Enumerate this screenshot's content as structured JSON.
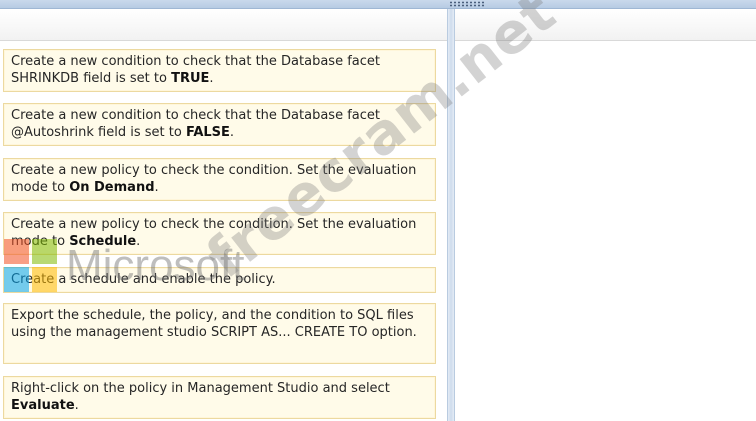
{
  "options": [
    {
      "pre": "Create a new condition to check that the Database facet SHRINKDB field is set to ",
      "strong": "TRUE",
      "post": "."
    },
    {
      "pre": "Create a new condition to check that the Database facet @Autoshrink field is set to ",
      "strong": "FALSE",
      "post": "."
    },
    {
      "pre": "Create a new policy to check the condition. Set the evaluation mode to ",
      "strong": "On Demand",
      "post": "."
    },
    {
      "pre": "Create a new policy to check the condition. Set the evaluation mode to ",
      "strong": "Schedule",
      "post": "."
    },
    {
      "pre": "Create a schedule and enable the policy.",
      "strong": "",
      "post": ""
    },
    {
      "pre": "Export the schedule, the policy, and the condition to SQL files using the management studio SCRIPT AS... CREATE TO option.",
      "strong": "",
      "post": ""
    },
    {
      "pre": "Right-click on the policy in Management Studio and select ",
      "strong": "Evaluate",
      "post": "."
    }
  ],
  "watermark": {
    "site": "freecram.net",
    "brand": "Microsoft",
    "logo_colors": [
      "#f25022",
      "#7fba00",
      "#00a4ef",
      "#ffb900"
    ]
  }
}
